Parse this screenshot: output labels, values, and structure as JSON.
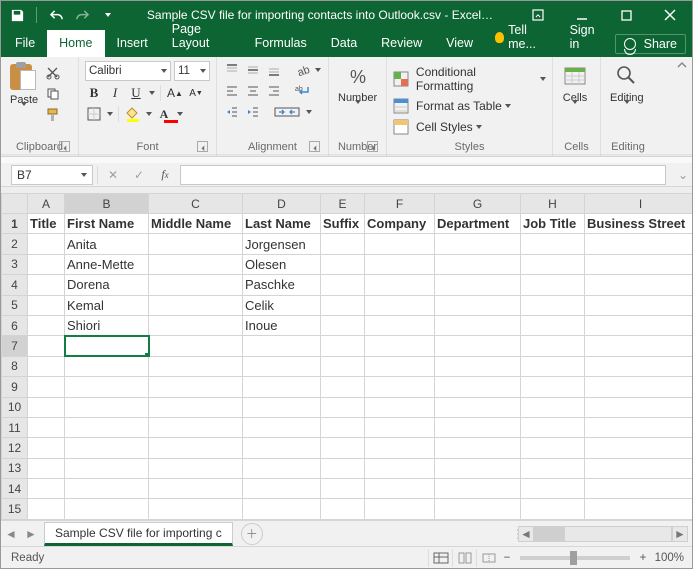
{
  "titlebar": {
    "title": "Sample CSV file for importing contacts into Outlook.csv - Excel…"
  },
  "tabs": {
    "file": "File",
    "home": "Home",
    "insert": "Insert",
    "pagelayout": "Page Layout",
    "formulas": "Formulas",
    "data": "Data",
    "review": "Review",
    "view": "View",
    "tellme": "Tell me...",
    "signin": "Sign in",
    "share": "Share"
  },
  "ribbon": {
    "clipboard": {
      "label": "Clipboard",
      "paste": "Paste"
    },
    "font": {
      "label": "Font",
      "name": "Calibri",
      "size": "11"
    },
    "alignment": {
      "label": "Alignment"
    },
    "number": {
      "label": "Number",
      "big": "Number"
    },
    "styles": {
      "label": "Styles",
      "cond": "Conditional Formatting",
      "table": "Format as Table",
      "cell": "Cell Styles"
    },
    "cells": {
      "label": "Cells",
      "big": "Cells"
    },
    "editing": {
      "label": "Editing",
      "big": "Editing"
    }
  },
  "namebox": {
    "value": "B7"
  },
  "grid": {
    "cols": [
      "A",
      "B",
      "C",
      "D",
      "E",
      "F",
      "G",
      "H",
      "I"
    ],
    "headers": [
      "Title",
      "First Name",
      "Middle Name",
      "Last Name",
      "Suffix",
      "Company",
      "Department",
      "Job Title",
      "Business Street"
    ],
    "rowlabels": [
      "1",
      "2",
      "3",
      "4",
      "5",
      "6",
      "7",
      "8",
      "9",
      "10",
      "11",
      "12",
      "13",
      "14",
      "15"
    ],
    "data": [
      {
        "first": "Anita",
        "last": "Jorgensen"
      },
      {
        "first": "Anne-Mette",
        "last": "Olesen"
      },
      {
        "first": "Dorena",
        "last": "Paschke"
      },
      {
        "first": "Kemal",
        "last": "Celik"
      },
      {
        "first": "Shiori",
        "last": "Inoue"
      }
    ],
    "selected": {
      "col": "B",
      "row": "7"
    }
  },
  "sheettabs": {
    "active": "Sample CSV file for importing c"
  },
  "status": {
    "ready": "Ready",
    "zoom": "100%"
  }
}
